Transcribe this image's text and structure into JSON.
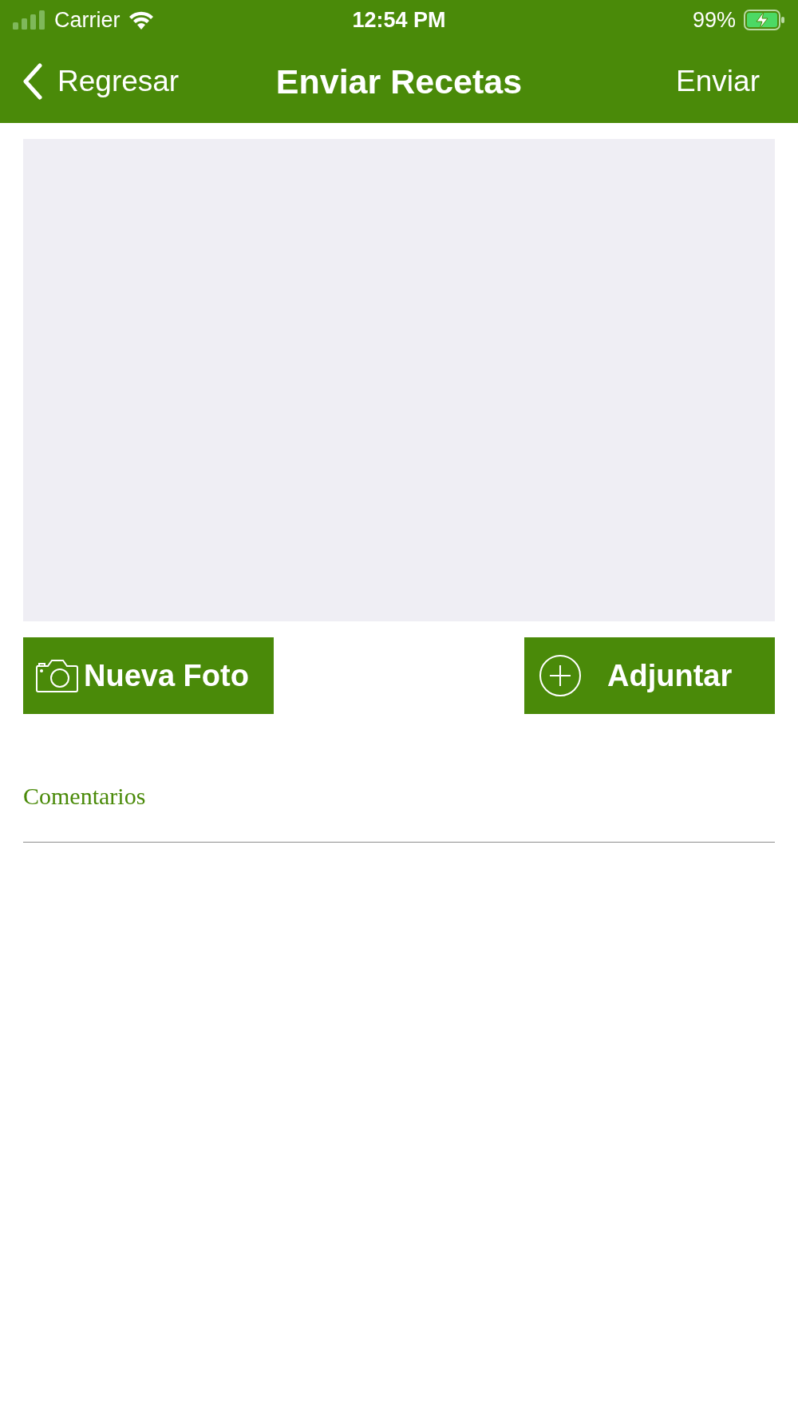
{
  "status_bar": {
    "carrier": "Carrier",
    "time": "12:54 PM",
    "battery": "99%"
  },
  "nav": {
    "back": "Regresar",
    "title": "Enviar Recetas",
    "action": "Enviar"
  },
  "photo": {
    "kind": "empty"
  },
  "buttons": [
    {
      "kind": "camera",
      "label": "Nueva Foto"
    },
    {
      "kind": "add",
      "label": "Adjuntar"
    }
  ],
  "comments": {
    "placeholder": "Comentarios"
  }
}
